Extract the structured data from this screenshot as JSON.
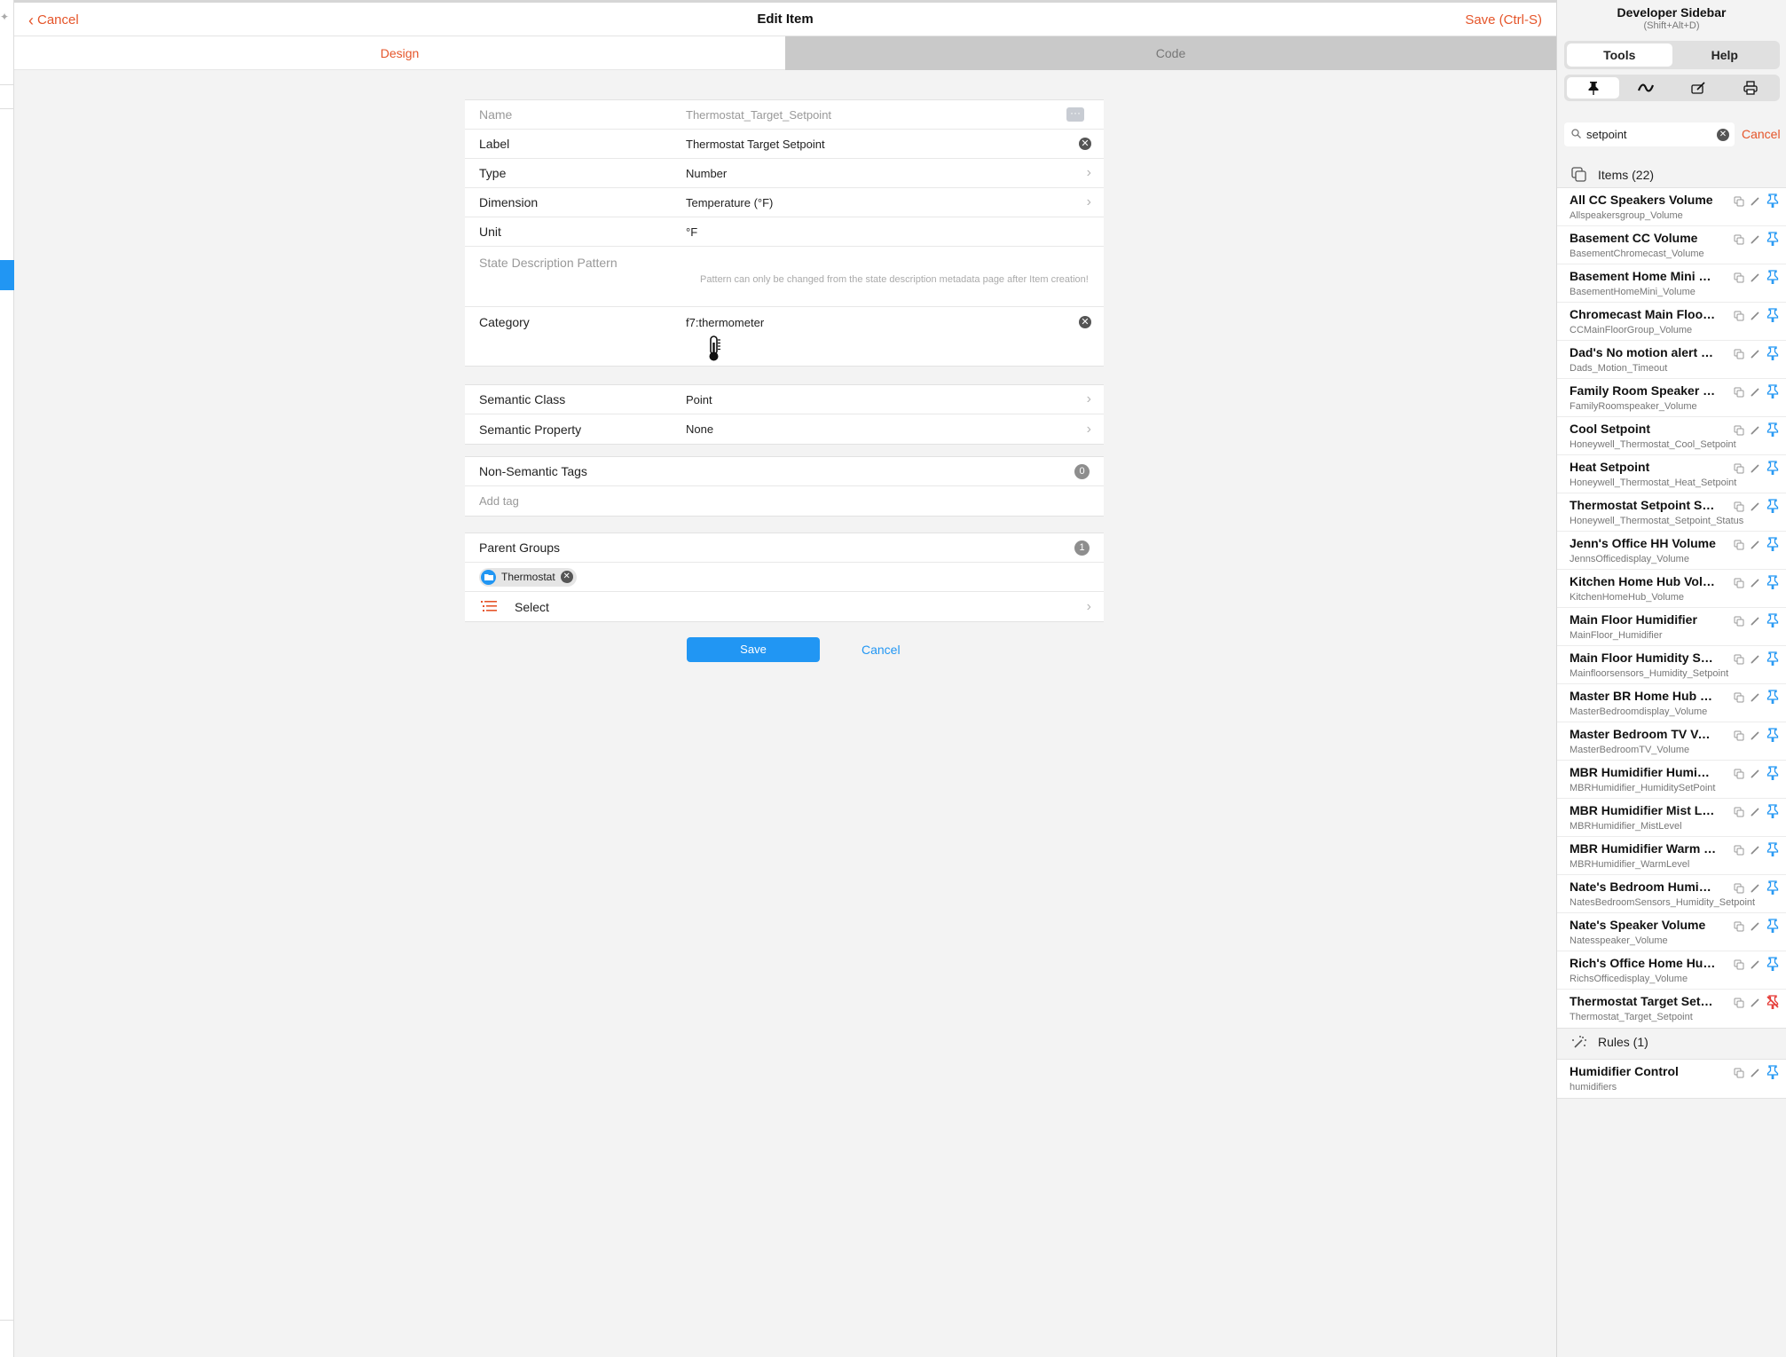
{
  "navbar": {
    "cancel_label": "Cancel",
    "title": "Edit Item",
    "save_label": "Save (Ctrl-S)"
  },
  "tabs": [
    {
      "label": "Design",
      "active": true
    },
    {
      "label": "Code",
      "active": false
    }
  ],
  "form": {
    "name": {
      "label": "Name",
      "value": "Thermostat_Target_Setpoint"
    },
    "label": {
      "label": "Label",
      "value": "Thermostat Target Setpoint"
    },
    "type": {
      "label": "Type",
      "value": "Number"
    },
    "dimension": {
      "label": "Dimension",
      "value": "Temperature (°F)"
    },
    "unit": {
      "label": "Unit",
      "value": "°F"
    },
    "state_description": {
      "label": "State Description Pattern",
      "note": "Pattern can only be changed from the state description metadata page after Item creation!"
    },
    "category": {
      "label": "Category",
      "value": "f7:thermometer",
      "icon": "thermometer-icon"
    },
    "semantic_class": {
      "label": "Semantic Class",
      "value": "Point"
    },
    "semantic_property": {
      "label": "Semantic Property",
      "value": "None"
    },
    "tags": {
      "label": "Non-Semantic Tags",
      "count": "0",
      "placeholder": "Add tag"
    },
    "parent_groups": {
      "label": "Parent Groups",
      "count": "1",
      "chip": "Thermostat",
      "select_label": "Select"
    },
    "save_button": "Save",
    "cancel_button": "Cancel"
  },
  "sidebar": {
    "title": "Developer Sidebar",
    "shortcut": "(Shift+Alt+D)",
    "tabs": [
      "Tools",
      "Help"
    ],
    "active_tab": "Tools",
    "tool_icons": [
      "pin-icon",
      "wave-icon",
      "edit-box-icon",
      "printer-icon"
    ],
    "search_value": "setpoint",
    "cancel_label": "Cancel",
    "items_header": "Items (22)",
    "items": [
      {
        "title": "All CC Speakers Volume",
        "name": "Allspeakersgroup_Volume",
        "pinned": false
      },
      {
        "title": "Basement CC Volume",
        "name": "BasementChromecast_Volume",
        "pinned": false
      },
      {
        "title": "Basement Home Mini Volume",
        "name": "BasementHomeMini_Volume",
        "pinned": false
      },
      {
        "title": "Chromecast Main Floor Group Volume",
        "name": "CCMainFloorGroup_Volume",
        "pinned": false
      },
      {
        "title": "Dad's No motion alert Timeout",
        "name": "Dads_Motion_Timeout",
        "pinned": false
      },
      {
        "title": "Family Room Speaker Volume",
        "name": "FamilyRoomspeaker_Volume",
        "pinned": false
      },
      {
        "title": "Cool Setpoint",
        "name": "Honeywell_Thermostat_Cool_Setpoint",
        "pinned": false
      },
      {
        "title": "Heat Setpoint",
        "name": "Honeywell_Thermostat_Heat_Setpoint",
        "pinned": false
      },
      {
        "title": "Thermostat Setpoint Status",
        "name": "Honeywell_Thermostat_Setpoint_Status",
        "pinned": false
      },
      {
        "title": "Jenn's Office HH Volume",
        "name": "JennsOfficedisplay_Volume",
        "pinned": false
      },
      {
        "title": "Kitchen Home Hub Volume",
        "name": "KitchenHomeHub_Volume",
        "pinned": false
      },
      {
        "title": "Main Floor Humidifier",
        "name": "MainFloor_Humidifier",
        "pinned": false
      },
      {
        "title": "Main Floor Humidity Setpoint",
        "name": "Mainfloorsensors_Humidity_Setpoint",
        "pinned": false
      },
      {
        "title": "Master BR Home Hub Volume",
        "name": "MasterBedroomdisplay_Volume",
        "pinned": false
      },
      {
        "title": "Master Bedroom TV Volume",
        "name": "MasterBedroomTV_Volume",
        "pinned": false
      },
      {
        "title": "MBR Humidifier Humidity SetPoint",
        "name": "MBRHumidifier_HumiditySetPoint",
        "pinned": false
      },
      {
        "title": "MBR Humidifier Mist Level",
        "name": "MBRHumidifier_MistLevel",
        "pinned": false
      },
      {
        "title": "MBR Humidifier Warm Level",
        "name": "MBRHumidifier_WarmLevel",
        "pinned": false
      },
      {
        "title": "Nate's Bedroom Humidity Setpoint",
        "name": "NatesBedroomSensors_Humidity_Setpoint",
        "pinned": false
      },
      {
        "title": "Nate's Speaker Volume",
        "name": "Natesspeaker_Volume",
        "pinned": false
      },
      {
        "title": "Rich's Office Home Hub Volume",
        "name": "RichsOfficedisplay_Volume",
        "pinned": false
      },
      {
        "title": "Thermostat Target Setpoint",
        "name": "Thermostat_Target_Setpoint",
        "pinned": true
      }
    ],
    "rules_header": "Rules (1)",
    "rules": [
      {
        "title": "Humidifier Control",
        "name": "humidifiers",
        "pinned": false
      }
    ]
  },
  "colors": {
    "accent": "#e5552a",
    "primary": "#2196f3",
    "pin_blue": "#2196f3",
    "pin_red": "#e53935"
  }
}
